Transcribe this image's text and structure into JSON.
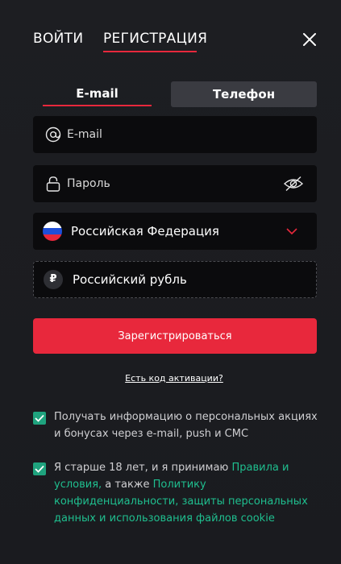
{
  "header": {
    "login_tab": "ВОЙТИ",
    "register_tab": "РЕГИСТРАЦИЯ",
    "close_icon": "close-icon"
  },
  "method_tabs": {
    "email": "E-mail",
    "phone": "Телефон"
  },
  "form": {
    "email_placeholder": "E-mail",
    "password_placeholder": "Пароль",
    "country": "Российская Федерация",
    "currency": "Российский рубль",
    "currency_symbol": "₽",
    "submit": "Зарегистрироваться",
    "activation_code_link": "Есть код активации?"
  },
  "consents": {
    "marketing": "Получать информацию о персональных акциях и бонусах через e-mail, push и СМС",
    "terms_prefix": "Я старше 18 лет, и я принимаю ",
    "terms_link": "Правила и условия,",
    "terms_middle": " а также ",
    "privacy_link": "Политику конфиденциальности, защиты персональных данных и использования файлов cookie"
  },
  "colors": {
    "accent": "#e8283c",
    "checkbox": "#1fa37e",
    "link": "#1fbf8f",
    "background": "#1d1e22",
    "field": "#0b0b0d"
  }
}
